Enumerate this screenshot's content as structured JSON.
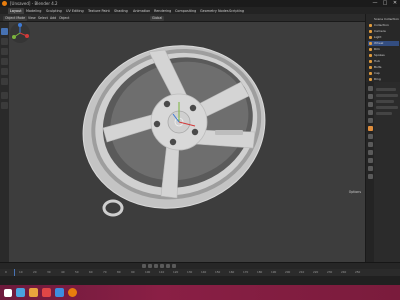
{
  "window": {
    "title": "[Unsaved] - Blender 4.2",
    "minimize_glyph": "—",
    "maximize_glyph": "□",
    "close_glyph": "✕"
  },
  "workspaces": [
    {
      "label": "Layout",
      "active": true
    },
    {
      "label": "Modeling"
    },
    {
      "label": "Sculpting"
    },
    {
      "label": "UV Editing"
    },
    {
      "label": "Texture Paint"
    },
    {
      "label": "Shading"
    },
    {
      "label": "Animation"
    },
    {
      "label": "Rendering"
    },
    {
      "label": "Compositing"
    },
    {
      "label": "Geometry Nodes"
    },
    {
      "label": "Scripting"
    }
  ],
  "header": {
    "mode": "Object Mode",
    "view": "View",
    "select": "Select",
    "add": "Add",
    "object": "Object",
    "transform": "Global"
  },
  "viewport": {
    "options_label": "Options"
  },
  "outliner": {
    "rows": [
      {
        "label": "Scene Collection"
      },
      {
        "label": "Collection"
      },
      {
        "label": "Camera"
      },
      {
        "label": "Light"
      },
      {
        "label": "Wheel",
        "selected": true
      },
      {
        "label": "Rim"
      },
      {
        "label": "Spokes"
      },
      {
        "label": "Hub"
      },
      {
        "label": "Bolts"
      },
      {
        "label": "Cap"
      },
      {
        "label": "Ring"
      }
    ]
  },
  "timeline": {
    "ticks": [
      "0",
      "10",
      "20",
      "30",
      "40",
      "50",
      "60",
      "70",
      "80",
      "90",
      "100",
      "110",
      "120",
      "130",
      "140",
      "150",
      "160",
      "170",
      "180",
      "190",
      "200",
      "210",
      "220",
      "230",
      "240",
      "250"
    ]
  },
  "colors": {
    "accent": "#4772b3",
    "blender_orange": "#e87d0d",
    "viewport_bg": "#3d3d3d",
    "taskbar": "#8a1f45"
  }
}
